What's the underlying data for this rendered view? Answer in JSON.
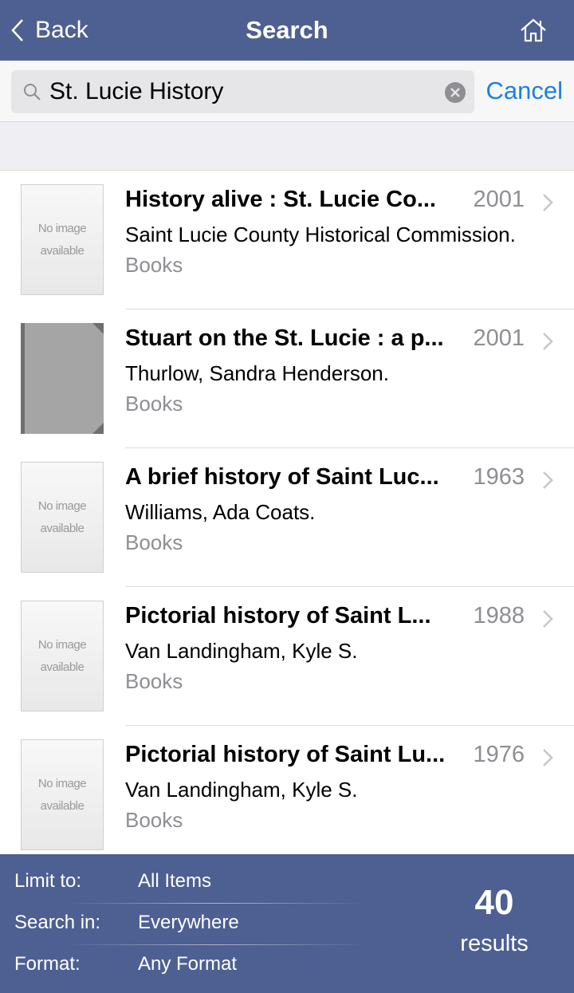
{
  "navbar": {
    "back_label": "Back",
    "title": "Search",
    "home_icon": "home-icon",
    "background": "#4e5f91"
  },
  "search": {
    "query": "St. Lucie History",
    "placeholder": "",
    "cancel_label": "Cancel",
    "accent": "#1a80e6"
  },
  "results": [
    {
      "title": "History alive : St. Lucie Co...",
      "year": "2001",
      "author": "Saint Lucie County Historical Commission.",
      "format": "Books",
      "thumbnail": "no-image",
      "thumb_text": [
        "No image",
        "available"
      ]
    },
    {
      "title": "Stuart on the St. Lucie : a p...",
      "year": "2001",
      "author": "Thurlow, Sandra Henderson.",
      "format": "Books",
      "thumbnail": "book-cover",
      "thumb_text": []
    },
    {
      "title": "A brief history of Saint Luc...",
      "year": "1963",
      "author": "Williams, Ada Coats.",
      "format": "Books",
      "thumbnail": "no-image",
      "thumb_text": [
        "No image",
        "available"
      ]
    },
    {
      "title": "Pictorial history of Saint L...",
      "year": "1988",
      "author": "Van Landingham, Kyle S.",
      "format": "Books",
      "thumbnail": "no-image",
      "thumb_text": [
        "No image",
        "available"
      ]
    },
    {
      "title": "Pictorial history of Saint Lu...",
      "year": "1976",
      "author": "Van Landingham, Kyle S.",
      "format": "Books",
      "thumbnail": "no-image",
      "thumb_text": [
        "No image",
        "available"
      ]
    }
  ],
  "footer": {
    "filters": [
      {
        "label": "Limit to:",
        "value": "All Items"
      },
      {
        "label": "Search in:",
        "value": "Everywhere"
      },
      {
        "label": "Format:",
        "value": "Any Format"
      }
    ],
    "count": "40",
    "count_label": "results"
  }
}
